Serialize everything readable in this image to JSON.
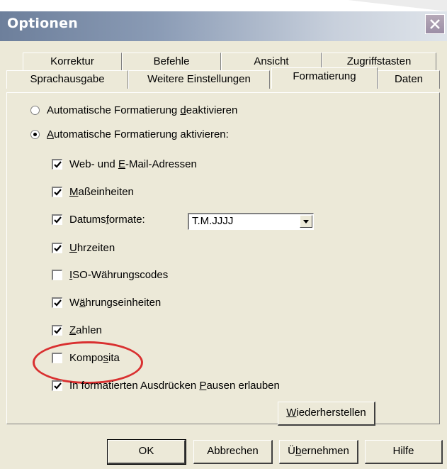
{
  "window": {
    "title": "Optionen"
  },
  "tabs": {
    "back_row": [
      {
        "label": "Korrektur"
      },
      {
        "label": "Befehle"
      },
      {
        "label": "Ansicht"
      },
      {
        "label": "Zugriffstasten"
      }
    ],
    "front_row": [
      {
        "label": "Sprachausgabe"
      },
      {
        "label": "Weitere Einstellungen"
      },
      {
        "label": "Formatierung",
        "active": true
      },
      {
        "label": "Daten"
      }
    ]
  },
  "formatting": {
    "radio_off": {
      "pre": "Automatische Formatierung ",
      "mn": "d",
      "post": "eaktivieren",
      "checked": false
    },
    "radio_on": {
      "pre": "",
      "mn": "A",
      "post": "utomatische Formatierung aktivieren:",
      "checked": true
    },
    "items": [
      {
        "pre": "Web- und ",
        "mn": "E",
        "post": "-Mail-Adressen",
        "checked": true
      },
      {
        "pre": "",
        "mn": "M",
        "post": "aßeinheiten",
        "checked": true
      },
      {
        "pre": "Datums",
        "mn": "f",
        "post": "ormate:",
        "checked": true
      },
      {
        "pre": "",
        "mn": "U",
        "post": "hrzeiten",
        "checked": true
      },
      {
        "pre": "",
        "mn": "I",
        "post": "SO-Währungscodes",
        "checked": false
      },
      {
        "pre": "W",
        "mn": "ä",
        "post": "hrungseinheiten",
        "checked": true
      },
      {
        "pre": "",
        "mn": "Z",
        "post": "ahlen",
        "checked": true
      },
      {
        "pre": "Kompo",
        "mn": "s",
        "post": "ita",
        "checked": false
      },
      {
        "pre": "In formatierten Ausdrücken ",
        "mn": "P",
        "post": "ausen erlauben",
        "checked": true
      }
    ],
    "date_format": {
      "value": "T.M.JJJJ"
    },
    "restore_button": {
      "pre": "",
      "mn": "W",
      "post": "iederherstellen"
    }
  },
  "buttons": {
    "ok": "OK",
    "cancel": "Abbrechen",
    "apply": {
      "pre": "Ü",
      "mn": "b",
      "post": "ernehmen"
    },
    "help": "Hilfe"
  },
  "annotation": {
    "color": "#d93030"
  }
}
